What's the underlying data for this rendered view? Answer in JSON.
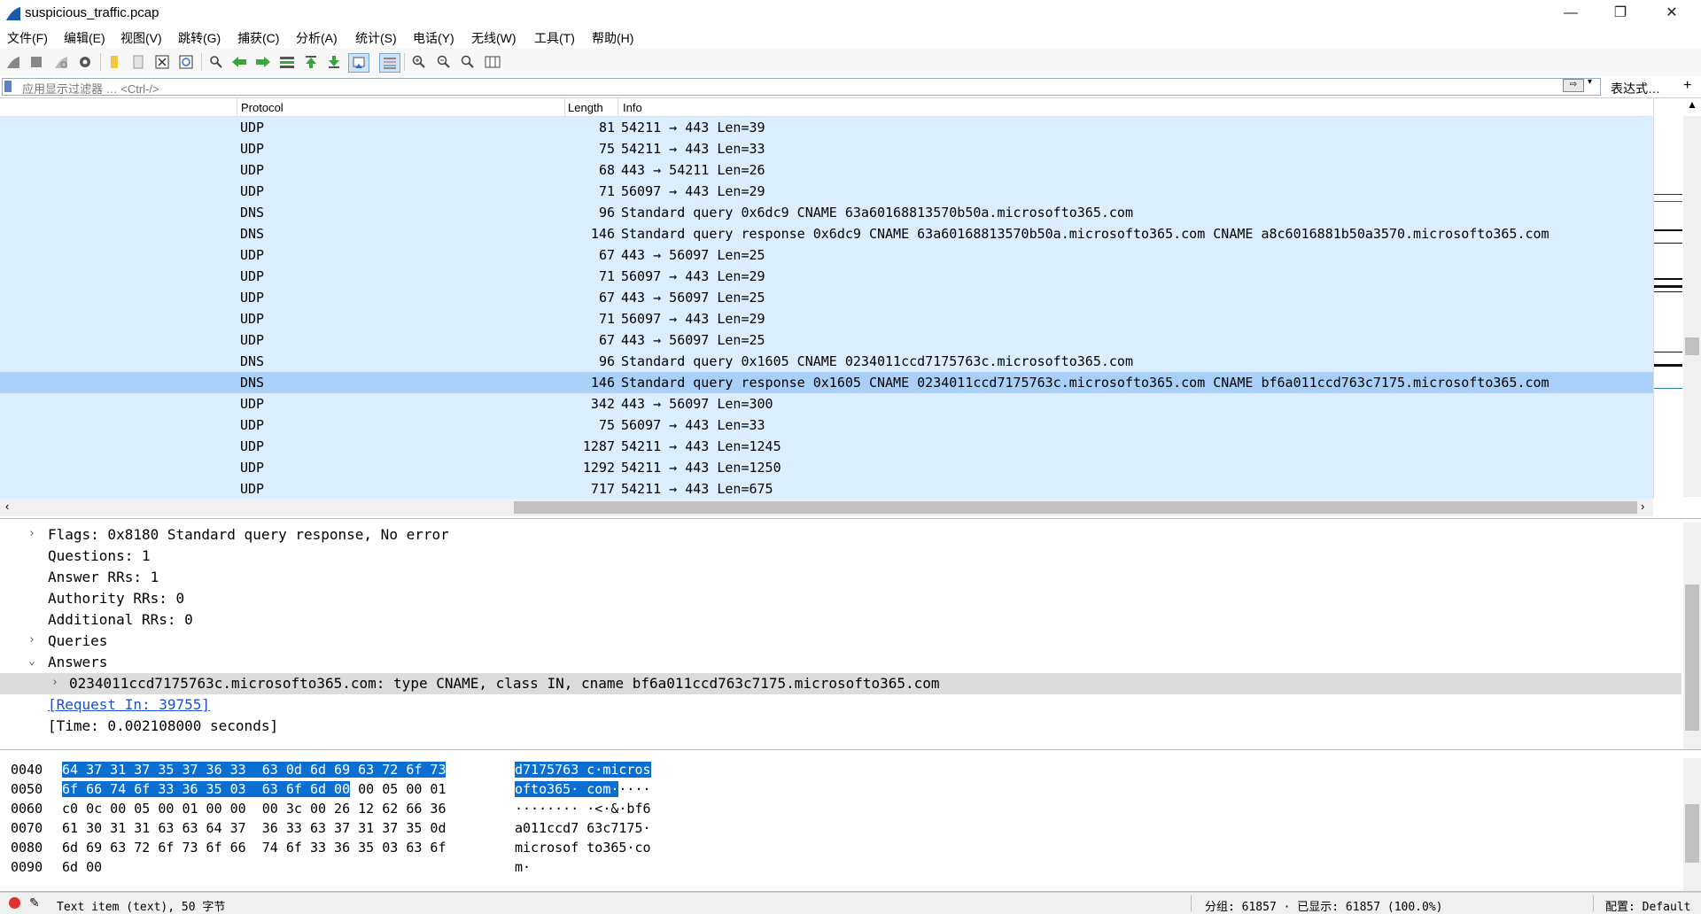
{
  "window": {
    "title": "suspicious_traffic.pcap",
    "minimize": "—",
    "restore": "❐",
    "close": "✕"
  },
  "menu": [
    "文件(F)",
    "编辑(E)",
    "视图(V)",
    "跳转(G)",
    "捕获(C)",
    "分析(A)",
    "统计(S)",
    "电话(Y)",
    "无线(W)",
    "工具(T)",
    "帮助(H)"
  ],
  "toolbar_icons": [
    "shark-fin-start-icon",
    "stop-icon",
    "restart-icon",
    "options-gear-icon",
    "open-file-icon",
    "save-file-icon",
    "close-file-icon",
    "reload-icon",
    "find-icon",
    "back-icon",
    "forward-icon",
    "goto-packet-icon",
    "first-packet-icon",
    "last-packet-icon",
    "autoscroll-icon",
    "colorize-icon",
    "zoom-in-icon",
    "zoom-out-icon",
    "normal-size-icon",
    "resize-columns-icon"
  ],
  "filter": {
    "placeholder": "应用显示过滤器 … <Ctrl-/>",
    "expression_label": "表达式…",
    "add_label": "+",
    "apply": "⇨",
    "dropdown": "▾"
  },
  "packet_list": {
    "columns": {
      "protocol": "Protocol",
      "length": "Length",
      "info": "Info"
    },
    "rows": [
      {
        "protocol": "UDP",
        "length": "81",
        "info": "54211 → 443 Len=39"
      },
      {
        "protocol": "UDP",
        "length": "75",
        "info": "54211 → 443 Len=33"
      },
      {
        "protocol": "UDP",
        "length": "68",
        "info": "443 → 54211 Len=26"
      },
      {
        "protocol": "UDP",
        "length": "71",
        "info": "56097 → 443 Len=29"
      },
      {
        "protocol": "DNS",
        "length": "96",
        "info": "Standard query 0x6dc9 CNAME 63a60168813570b50a.microsofto365.com"
      },
      {
        "protocol": "DNS",
        "length": "146",
        "info": "Standard query response 0x6dc9 CNAME 63a60168813570b50a.microsofto365.com CNAME a8c6016881b50a3570.microsofto365.com"
      },
      {
        "protocol": "UDP",
        "length": "67",
        "info": "443 → 56097 Len=25"
      },
      {
        "protocol": "UDP",
        "length": "71",
        "info": "56097 → 443 Len=29"
      },
      {
        "protocol": "UDP",
        "length": "67",
        "info": "443 → 56097 Len=25"
      },
      {
        "protocol": "UDP",
        "length": "71",
        "info": "56097 → 443 Len=29"
      },
      {
        "protocol": "UDP",
        "length": "67",
        "info": "443 → 56097 Len=25"
      },
      {
        "protocol": "DNS",
        "length": "96",
        "info": "Standard query 0x1605 CNAME 0234011ccd7175763c.microsofto365.com"
      },
      {
        "protocol": "DNS",
        "length": "146",
        "info": "Standard query response 0x1605 CNAME 0234011ccd7175763c.microsofto365.com CNAME bf6a011ccd763c7175.microsofto365.com",
        "selected": true
      },
      {
        "protocol": "UDP",
        "length": "342",
        "info": "443 → 56097 Len=300"
      },
      {
        "protocol": "UDP",
        "length": "75",
        "info": "56097 → 443 Len=33"
      },
      {
        "protocol": "UDP",
        "length": "1287",
        "info": "54211 → 443 Len=1245"
      },
      {
        "protocol": "UDP",
        "length": "1292",
        "info": "54211 → 443 Len=1250"
      },
      {
        "protocol": "UDP",
        "length": "717",
        "info": "54211 → 443 Len=675"
      }
    ]
  },
  "details": {
    "lines": [
      {
        "arrow": "›",
        "text": "Flags: 0x8180 Standard query response, No error",
        "indent": 1
      },
      {
        "arrow": "",
        "text": "Questions: 1",
        "indent": 1
      },
      {
        "arrow": "",
        "text": "Answer RRs: 1",
        "indent": 1
      },
      {
        "arrow": "",
        "text": "Authority RRs: 0",
        "indent": 1
      },
      {
        "arrow": "",
        "text": "Additional RRs: 0",
        "indent": 1
      },
      {
        "arrow": "›",
        "text": "Queries",
        "indent": 1
      },
      {
        "arrow": "⌄",
        "text": "Answers",
        "indent": 1
      },
      {
        "arrow": "›",
        "text": "0234011ccd7175763c.microsofto365.com: type CNAME, class IN, cname bf6a011ccd763c7175.microsofto365.com",
        "indent": 2,
        "highlight": true
      },
      {
        "arrow": "",
        "text": "[Request In: 39755]",
        "indent": 1,
        "link": true
      },
      {
        "arrow": "",
        "text": "[Time: 0.002108000 seconds]",
        "indent": 1
      }
    ]
  },
  "bytes": {
    "lines": [
      {
        "offset": "0040",
        "hex_sel": "64 37 31 37 35 37 36 33  63 0d 6d 69 63 72 6f 73",
        "hex_rest": "",
        "ascii_sel": "d7175763 c·micros",
        "ascii_rest": ""
      },
      {
        "offset": "0050",
        "hex_sel": "6f 66 74 6f 33 36 35 03  63 6f 6d 00",
        "hex_rest": " 00 05 00 01",
        "ascii_sel": "ofto365· com·",
        "ascii_rest": "····"
      },
      {
        "offset": "0060",
        "hex_sel": "",
        "hex_rest": "c0 0c 00 05 00 01 00 00  00 3c 00 26 12 62 66 36",
        "ascii_sel": "",
        "ascii_rest": "········ ·<·&·bf6"
      },
      {
        "offset": "0070",
        "hex_sel": "",
        "hex_rest": "61 30 31 31 63 63 64 37  36 33 63 37 31 37 35 0d",
        "ascii_sel": "",
        "ascii_rest": "a011ccd7 63c7175·"
      },
      {
        "offset": "0080",
        "hex_sel": "",
        "hex_rest": "6d 69 63 72 6f 73 6f 66  74 6f 33 36 35 03 63 6f",
        "ascii_sel": "",
        "ascii_rest": "microsof to365·co"
      },
      {
        "offset": "0090",
        "hex_sel": "",
        "hex_rest": "6d 00",
        "ascii_sel": "",
        "ascii_rest": "m·"
      }
    ]
  },
  "status": {
    "item_text": "Text item (text), 50 字节",
    "packets": "分组: 61857 · 已显示: 61857 (100.0%)",
    "profile": "配置: Default",
    "status_color": "#e03030"
  }
}
